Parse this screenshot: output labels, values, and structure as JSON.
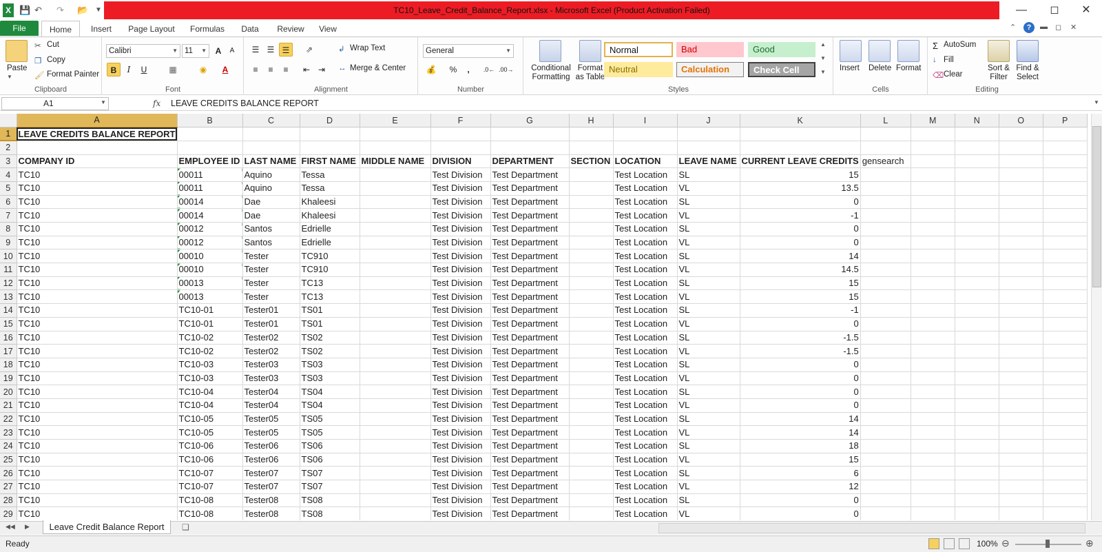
{
  "window": {
    "title": "TC10_Leave_Credit_Balance_Report.xlsx - Microsoft Excel (Product Activation Failed)"
  },
  "ribbon_tabs": [
    "File",
    "Home",
    "Insert",
    "Page Layout",
    "Formulas",
    "Data",
    "Review",
    "View"
  ],
  "clipboard": {
    "paste": "Paste",
    "cut": "Cut",
    "copy": "Copy",
    "format_painter": "Format Painter",
    "label": "Clipboard"
  },
  "font": {
    "name": "Calibri",
    "size": "11",
    "label": "Font",
    "bold": "B",
    "italic": "I",
    "underline": "U"
  },
  "alignment": {
    "wrap": "Wrap Text",
    "merge": "Merge & Center",
    "label": "Alignment"
  },
  "number": {
    "format": "General",
    "percent": "%",
    "comma": ",",
    "label": "Number"
  },
  "styles": {
    "conditional": "Conditional",
    "conditional2": "Formatting",
    "format_table": "Format",
    "format_table2": "as Table",
    "normal": "Normal",
    "bad": "Bad",
    "good": "Good",
    "neutral": "Neutral",
    "calculation": "Calculation",
    "check": "Check Cell",
    "label": "Styles"
  },
  "cells": {
    "insert": "Insert",
    "delete": "Delete",
    "format": "Format",
    "label": "Cells"
  },
  "editing": {
    "autosum": "AutoSum",
    "fill": "Fill",
    "clear": "Clear",
    "sort": "Sort &",
    "sort2": "Filter",
    "find": "Find &",
    "find2": "Select",
    "label": "Editing"
  },
  "formula_bar": {
    "name_box": "A1",
    "fx": "fx",
    "content": "LEAVE CREDITS BALANCE REPORT"
  },
  "columns": [
    "A",
    "B",
    "C",
    "D",
    "E",
    "F",
    "G",
    "H",
    "I",
    "J",
    "K",
    "L",
    "M",
    "N",
    "O",
    "P"
  ],
  "title_cell": "LEAVE CREDITS BALANCE REPORT",
  "headers": [
    "COMPANY ID",
    "EMPLOYEE ID",
    "LAST NAME",
    "FIRST NAME",
    "MIDDLE NAME",
    "DIVISION",
    "DEPARTMENT",
    "SECTION",
    "LOCATION",
    "LEAVE NAME",
    "CURRENT LEAVE CREDITS",
    "gensearch"
  ],
  "rows": [
    [
      "TC10",
      "00011",
      "Aquino",
      "Tessa",
      "",
      "Test Division",
      "Test Department",
      "",
      "Test Location",
      "SL",
      "15"
    ],
    [
      "TC10",
      "00011",
      "Aquino",
      "Tessa",
      "",
      "Test Division",
      "Test Department",
      "",
      "Test Location",
      "VL",
      "13.5"
    ],
    [
      "TC10",
      "00014",
      "Dae",
      "Khaleesi",
      "",
      "Test Division",
      "Test Department",
      "",
      "Test Location",
      "SL",
      "0"
    ],
    [
      "TC10",
      "00014",
      "Dae",
      "Khaleesi",
      "",
      "Test Division",
      "Test Department",
      "",
      "Test Location",
      "VL",
      "-1"
    ],
    [
      "TC10",
      "00012",
      "Santos",
      "Edrielle",
      "",
      "Test Division",
      "Test Department",
      "",
      "Test Location",
      "SL",
      "0"
    ],
    [
      "TC10",
      "00012",
      "Santos",
      "Edrielle",
      "",
      "Test Division",
      "Test Department",
      "",
      "Test Location",
      "VL",
      "0"
    ],
    [
      "TC10",
      "00010",
      "Tester",
      "TC910",
      "",
      "Test Division",
      "Test Department",
      "",
      "Test Location",
      "SL",
      "14"
    ],
    [
      "TC10",
      "00010",
      "Tester",
      "TC910",
      "",
      "Test Division",
      "Test Department",
      "",
      "Test Location",
      "VL",
      "14.5"
    ],
    [
      "TC10",
      "00013",
      "Tester",
      "TC13",
      "",
      "Test Division",
      "Test Department",
      "",
      "Test Location",
      "SL",
      "15"
    ],
    [
      "TC10",
      "00013",
      "Tester",
      "TC13",
      "",
      "Test Division",
      "Test Department",
      "",
      "Test Location",
      "VL",
      "15"
    ],
    [
      "TC10",
      "TC10-01",
      "Tester01",
      "TS01",
      "",
      "Test Division",
      "Test Department",
      "",
      "Test Location",
      "SL",
      "-1"
    ],
    [
      "TC10",
      "TC10-01",
      "Tester01",
      "TS01",
      "",
      "Test Division",
      "Test Department",
      "",
      "Test Location",
      "VL",
      "0"
    ],
    [
      "TC10",
      "TC10-02",
      "Tester02",
      "TS02",
      "",
      "Test Division",
      "Test Department",
      "",
      "Test Location",
      "SL",
      "-1.5"
    ],
    [
      "TC10",
      "TC10-02",
      "Tester02",
      "TS02",
      "",
      "Test Division",
      "Test Department",
      "",
      "Test Location",
      "VL",
      "-1.5"
    ],
    [
      "TC10",
      "TC10-03",
      "Tester03",
      "TS03",
      "",
      "Test Division",
      "Test Department",
      "",
      "Test Location",
      "SL",
      "0"
    ],
    [
      "TC10",
      "TC10-03",
      "Tester03",
      "TS03",
      "",
      "Test Division",
      "Test Department",
      "",
      "Test Location",
      "VL",
      "0"
    ],
    [
      "TC10",
      "TC10-04",
      "Tester04",
      "TS04",
      "",
      "Test Division",
      "Test Department",
      "",
      "Test Location",
      "SL",
      "0"
    ],
    [
      "TC10",
      "TC10-04",
      "Tester04",
      "TS04",
      "",
      "Test Division",
      "Test Department",
      "",
      "Test Location",
      "VL",
      "0"
    ],
    [
      "TC10",
      "TC10-05",
      "Tester05",
      "TS05",
      "",
      "Test Division",
      "Test Department",
      "",
      "Test Location",
      "SL",
      "14"
    ],
    [
      "TC10",
      "TC10-05",
      "Tester05",
      "TS05",
      "",
      "Test Division",
      "Test Department",
      "",
      "Test Location",
      "VL",
      "14"
    ],
    [
      "TC10",
      "TC10-06",
      "Tester06",
      "TS06",
      "",
      "Test Division",
      "Test Department",
      "",
      "Test Location",
      "SL",
      "18"
    ],
    [
      "TC10",
      "TC10-06",
      "Tester06",
      "TS06",
      "",
      "Test Division",
      "Test Department",
      "",
      "Test Location",
      "VL",
      "15"
    ],
    [
      "TC10",
      "TC10-07",
      "Tester07",
      "TS07",
      "",
      "Test Division",
      "Test Department",
      "",
      "Test Location",
      "SL",
      "6"
    ],
    [
      "TC10",
      "TC10-07",
      "Tester07",
      "TS07",
      "",
      "Test Division",
      "Test Department",
      "",
      "Test Location",
      "VL",
      "12"
    ],
    [
      "TC10",
      "TC10-08",
      "Tester08",
      "TS08",
      "",
      "Test Division",
      "Test Department",
      "",
      "Test Location",
      "SL",
      "0"
    ],
    [
      "TC10",
      "TC10-08",
      "Tester08",
      "TS08",
      "",
      "Test Division",
      "Test Department",
      "",
      "Test Location",
      "VL",
      "0"
    ]
  ],
  "sheet_tab": "Leave Credit Balance Report",
  "status": {
    "ready": "Ready",
    "zoom": "100%"
  }
}
